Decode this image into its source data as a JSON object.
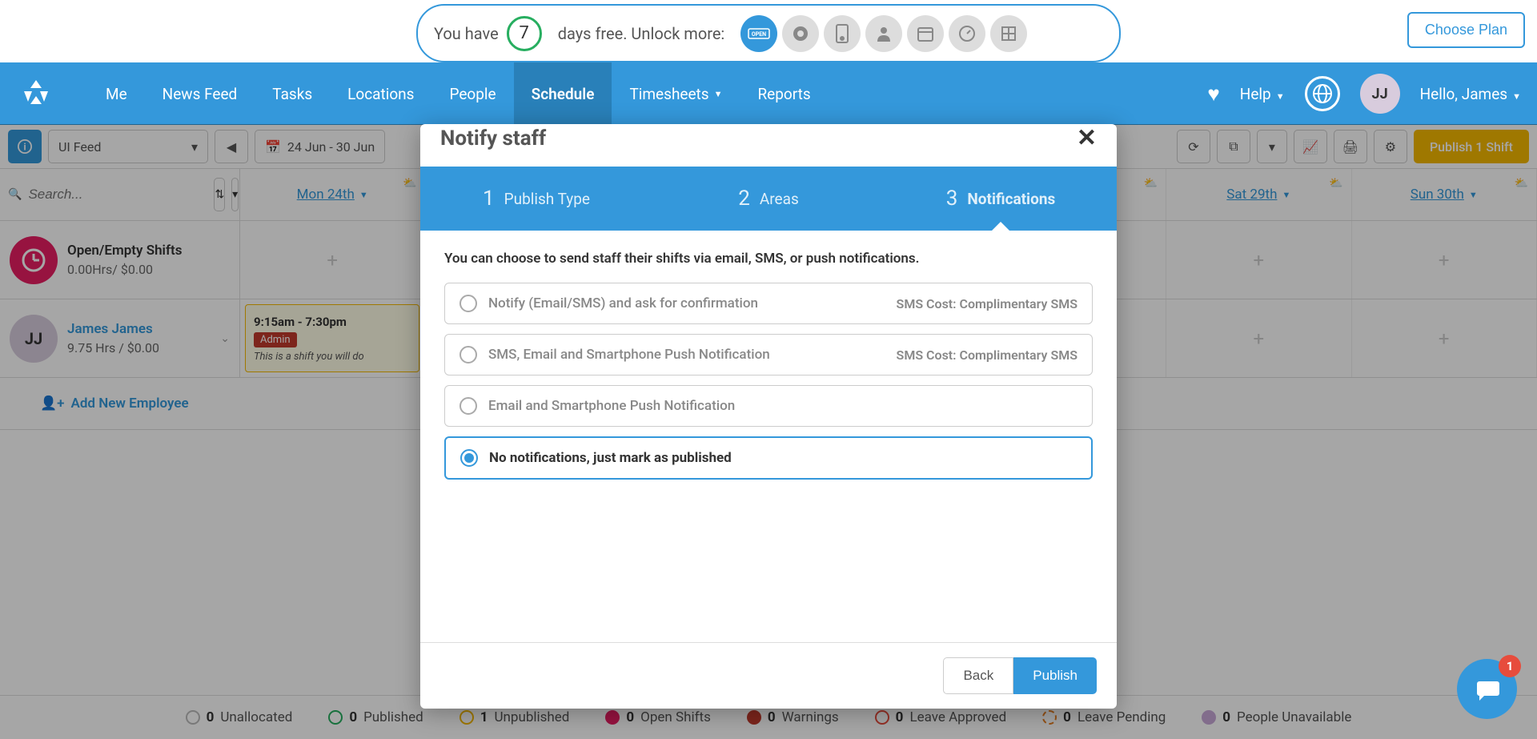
{
  "trial": {
    "prefix": "You have",
    "days": "7",
    "suffix": "days free. Unlock more:",
    "choose_plan": "Choose Plan"
  },
  "nav": {
    "items": [
      "Me",
      "News Feed",
      "Tasks",
      "Locations",
      "People",
      "Schedule",
      "Timesheets",
      "Reports"
    ],
    "active_index": 5,
    "help": "Help",
    "hello": "Hello, James",
    "avatar_initials": "JJ"
  },
  "toolbar": {
    "feed_select": "UI Feed",
    "date_range": "24 Jun - 30 Jun",
    "publish_label": "Publish 1 Shift"
  },
  "schedule": {
    "search_placeholder": "Search...",
    "days": [
      "Mon 24th",
      "",
      "",
      "",
      "",
      "Sat 29th",
      "Sun 30th"
    ],
    "open_row": {
      "title": "Open/Empty Shifts",
      "sub": "0.00Hrs/ $0.00"
    },
    "user_row": {
      "name": "James James",
      "initials": "JJ",
      "sub": "9.75 Hrs / $0.00",
      "shift": {
        "time": "9:15am - 7:30pm",
        "badge": "Admin",
        "desc": "This is a shift you will do"
      }
    },
    "add_employee": "Add New Employee"
  },
  "modal": {
    "title": "Notify staff",
    "steps": [
      {
        "num": "1",
        "label": "Publish Type"
      },
      {
        "num": "2",
        "label": "Areas"
      },
      {
        "num": "3",
        "label": "Notifications"
      }
    ],
    "active_step": 2,
    "desc": "You can choose to send staff their shifts via email, SMS, or push notifications.",
    "options": [
      {
        "label": "Notify (Email/SMS) and ask for confirmation",
        "cost": "SMS Cost: Complimentary SMS",
        "selected": false
      },
      {
        "label": "SMS, Email and Smartphone Push Notification",
        "cost": "SMS Cost: Complimentary SMS",
        "selected": false
      },
      {
        "label": "Email and Smartphone Push Notification",
        "cost": "",
        "selected": false
      },
      {
        "label": "No notifications, just mark as published",
        "cost": "",
        "selected": true
      }
    ],
    "back": "Back",
    "publish": "Publish"
  },
  "footer": {
    "stats": [
      {
        "count": "0",
        "label": "Unallocated",
        "color": "#bbb"
      },
      {
        "count": "0",
        "label": "Published",
        "color": "#27ae60"
      },
      {
        "count": "1",
        "label": "Unpublished",
        "color": "#f5b800"
      },
      {
        "count": "0",
        "label": "Open Shifts",
        "color": "#e91e63"
      },
      {
        "count": "0",
        "label": "Warnings",
        "color": "#c0392b"
      },
      {
        "count": "0",
        "label": "Leave Approved",
        "color": "#e74c3c"
      },
      {
        "count": "0",
        "label": "Leave Pending",
        "color": "#e67e22"
      },
      {
        "count": "0",
        "label": "People Unavailable",
        "color": "#9b59b6"
      }
    ]
  },
  "chat": {
    "badge": "1"
  }
}
